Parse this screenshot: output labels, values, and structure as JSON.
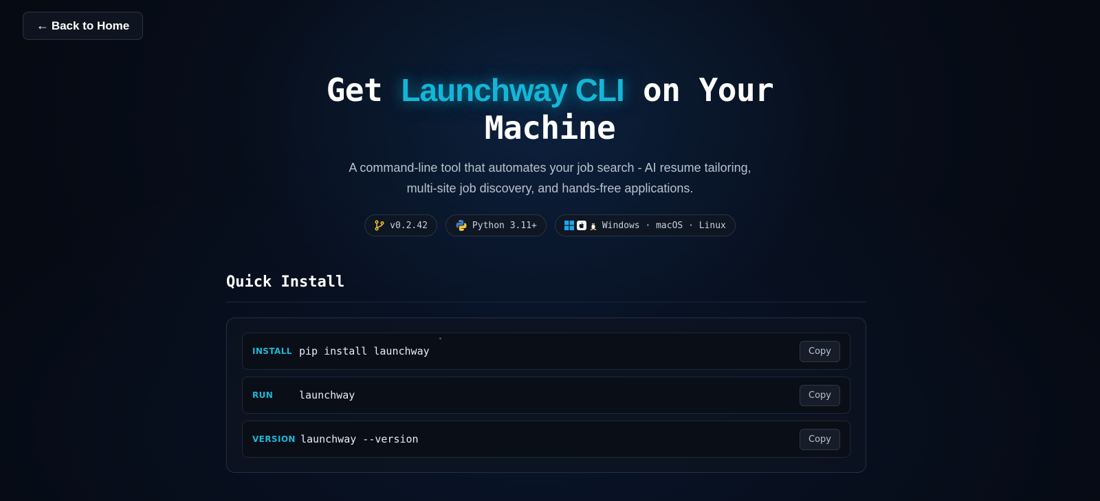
{
  "nav": {
    "back_arrow": "←",
    "back_label": "Back to Home"
  },
  "hero": {
    "title_prefix": "Get",
    "title_accent": "Launchway CLI",
    "title_suffix": "on Your",
    "title_line2": "Machine",
    "subtitle_line1": "A command-line tool that automates your job search - AI resume tailoring,",
    "subtitle_line2": "multi-site job discovery, and hands-free applications."
  },
  "badges": [
    {
      "icon": "git-branch-icon",
      "label": "v0.2.42"
    },
    {
      "icon": "python-icon",
      "label": "Python 3.11+"
    },
    {
      "icon": "os-icons",
      "label": "Windows · macOS · Linux"
    }
  ],
  "quick_install": {
    "title": "Quick Install",
    "commands": [
      {
        "label": "INSTALL",
        "command": "pip install launchway",
        "copy_label": "Copy"
      },
      {
        "label": "RUN",
        "command": "launchway",
        "copy_label": "Copy"
      },
      {
        "label": "VERSION",
        "command": "launchway --version",
        "copy_label": "Copy"
      }
    ]
  },
  "colors": {
    "accent": "#14b6d8",
    "background": "#060a13",
    "card_border": "#253043"
  }
}
